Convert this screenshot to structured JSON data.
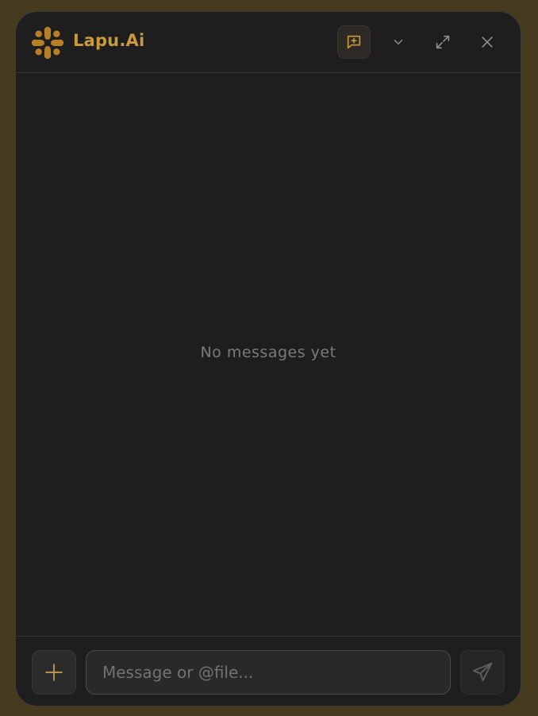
{
  "header": {
    "title": "Lapu.Ai",
    "icons": {
      "logo": "lapu-logo-icon",
      "new_chat": "new-chat-icon",
      "dropdown": "chevron-down-icon",
      "expand": "expand-icon",
      "close": "close-icon"
    }
  },
  "messages": {
    "empty_text": "No messages yet"
  },
  "composer": {
    "placeholder": "Message or @file...",
    "value": "",
    "icons": {
      "add": "plus-icon",
      "send": "send-icon"
    }
  },
  "colors": {
    "background": "#463b1f",
    "panel": "#1e1e1f",
    "accent": "#c99a3b"
  }
}
